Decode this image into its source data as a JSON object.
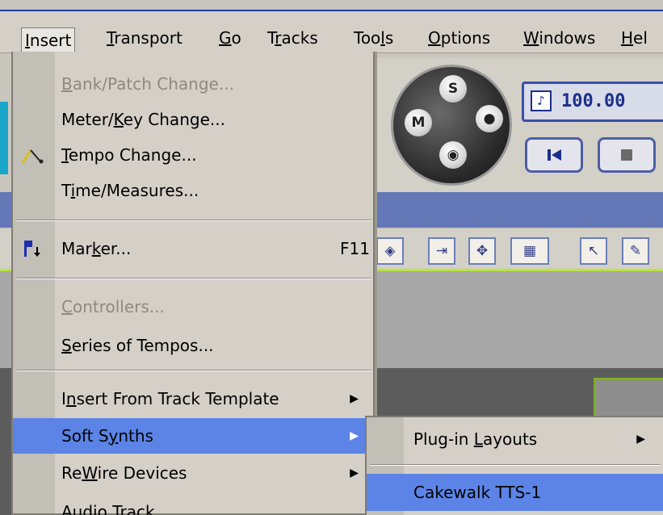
{
  "menubar": {
    "items": [
      {
        "label": "Insert",
        "mn": "I",
        "rest": "nsert"
      },
      {
        "label": "Transport",
        "mn": "T",
        "rest": "ransport"
      },
      {
        "label": "Go",
        "mn": "G",
        "rest": "o"
      },
      {
        "label": "Tracks",
        "pre": "T",
        "mn": "r",
        "rest": "acks"
      },
      {
        "label": "Tools",
        "pre": "Too",
        "mn": "l",
        "rest": "s"
      },
      {
        "label": "Options",
        "mn": "O",
        "rest": "ptions"
      },
      {
        "label": "Windows",
        "mn": "W",
        "rest": "indows"
      },
      {
        "label": "Hel",
        "mn": "H",
        "rest": "el"
      }
    ]
  },
  "transport": {
    "tempo_display": "100.00",
    "orb_labels": {
      "solo": "S",
      "mute": "M"
    }
  },
  "insert_menu": {
    "items": [
      {
        "pre": "",
        "mn": "B",
        "rest": "ank/Patch Change...",
        "disabled": true
      },
      {
        "pre": "Meter/",
        "mn": "K",
        "rest": "ey Change..."
      },
      {
        "pre": "",
        "mn": "T",
        "rest": "empo Change...",
        "icon": "tempo-icon"
      },
      {
        "pre": "T",
        "mn": "i",
        "rest": "me/Measures..."
      },
      {
        "pre": "Mar",
        "mn": "k",
        "rest": "er...",
        "shortcut": "F11",
        "icon": "marker-flag-icon"
      },
      {
        "pre": "",
        "mn": "C",
        "rest": "ontrollers...",
        "disabled": true
      },
      {
        "pre": "",
        "mn": "S",
        "rest": "eries of Tempos..."
      },
      {
        "pre": "I",
        "mn": "n",
        "rest": "sert From Track Template",
        "submenu": true
      },
      {
        "pre": "Soft S",
        "mn": "y",
        "rest": "nths",
        "submenu": true,
        "selected": true
      },
      {
        "pre": "Re",
        "mn": "W",
        "rest": "ire Devices",
        "submenu": true
      },
      {
        "pre": "Audio Track",
        "mn": "",
        "rest": ""
      }
    ]
  },
  "soft_synths_submenu": {
    "items": [
      {
        "pre": "Plug-in ",
        "mn": "L",
        "rest": "ayouts",
        "submenu": true
      },
      {
        "pre": "Cakewalk TTS-1",
        "mn": "",
        "rest": "",
        "selected": true
      }
    ]
  },
  "colors": {
    "menu_bg": "#d4d0c8",
    "highlight": "#5c84e6",
    "title_blue": "#1a3fa8"
  }
}
